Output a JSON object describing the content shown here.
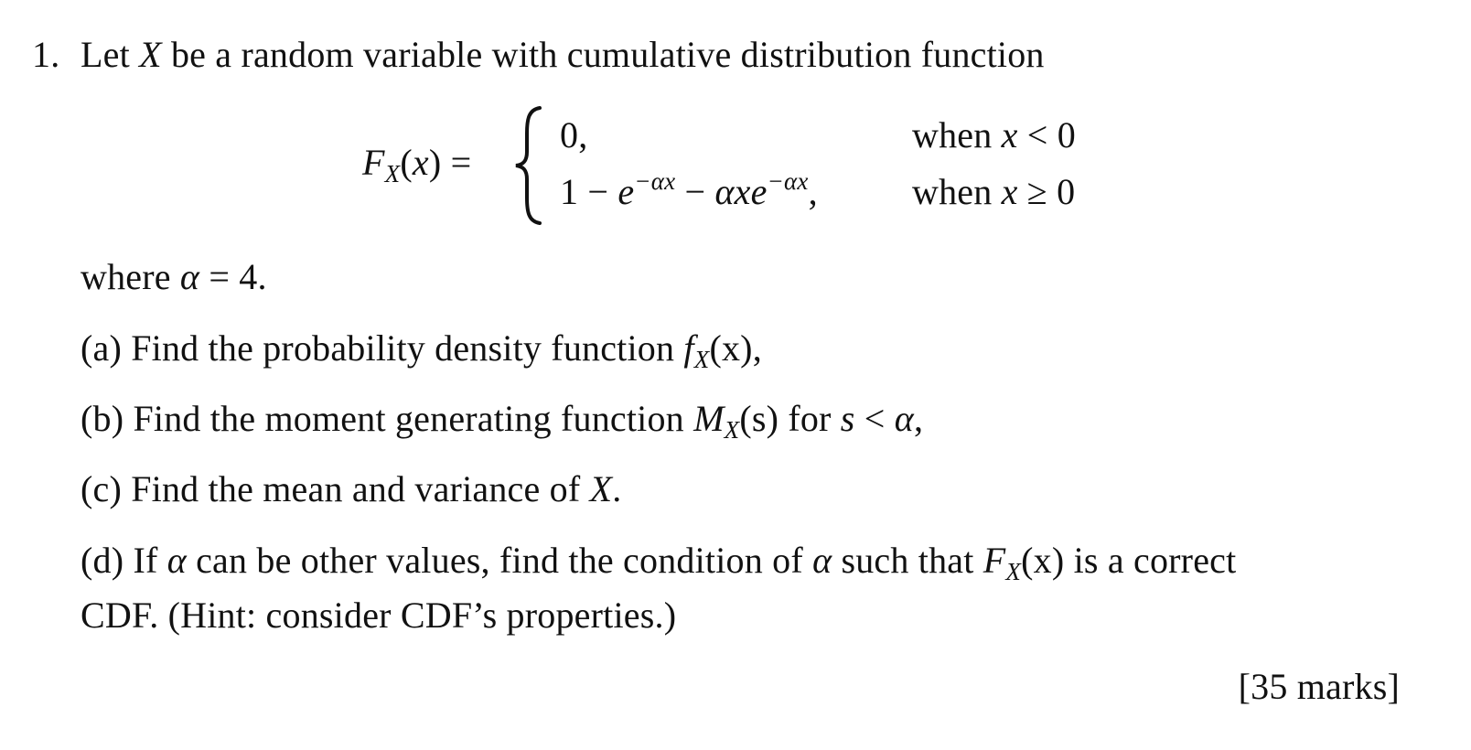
{
  "question": {
    "number": "1.",
    "intro": {
      "before": "Let ",
      "var": "X",
      "after": " be a random variable with cumulative distribution function"
    },
    "cdf": {
      "lhs_func": "F",
      "lhs_sub": "X",
      "lhs_arg_open": "(",
      "lhs_arg": "x",
      "lhs_arg_close": ")",
      "equals": " = ",
      "cases": [
        {
          "expr": "0,",
          "condition_word": "when ",
          "condition_var": "x",
          "condition_rel": " < 0"
        },
        {
          "expr_parts": {
            "one_minus": "1 − ",
            "e1": "e",
            "e1_exp": "−αx",
            "minus": " − ",
            "alpha_x": "αx",
            "e2": "e",
            "e2_exp": "−αx",
            "comma": ","
          },
          "condition_word": "when ",
          "condition_var": "x",
          "condition_rel": " ≥ 0"
        }
      ]
    },
    "where": {
      "before": "where ",
      "var": "α",
      "after": " = 4."
    },
    "parts": {
      "a": {
        "label": "(a)",
        "text": " Find the probability density function ",
        "func": "f",
        "sub": "X",
        "arg": "(x)",
        "tail": ","
      },
      "b": {
        "label": "(b)",
        "text": " Find the moment generating function ",
        "func": "M",
        "sub": "X",
        "arg": "(s)",
        "mid": " for ",
        "var": "s",
        "rel": " < ",
        "var2": "α",
        "tail": ","
      },
      "c": {
        "label": "(c)",
        "text": " Find the mean and variance of ",
        "var": "X",
        "tail": "."
      },
      "d": {
        "label": "(d)",
        "text1": " If ",
        "var1": "α",
        "text2": " can be other values, find the condition of ",
        "var2": "α",
        "text3": " such that ",
        "func": "F",
        "sub": "X",
        "arg": "(x)",
        "text4": " is a correct",
        "line2": "CDF. (Hint: consider CDF’s properties.)"
      }
    },
    "marks": "[35 marks]"
  }
}
